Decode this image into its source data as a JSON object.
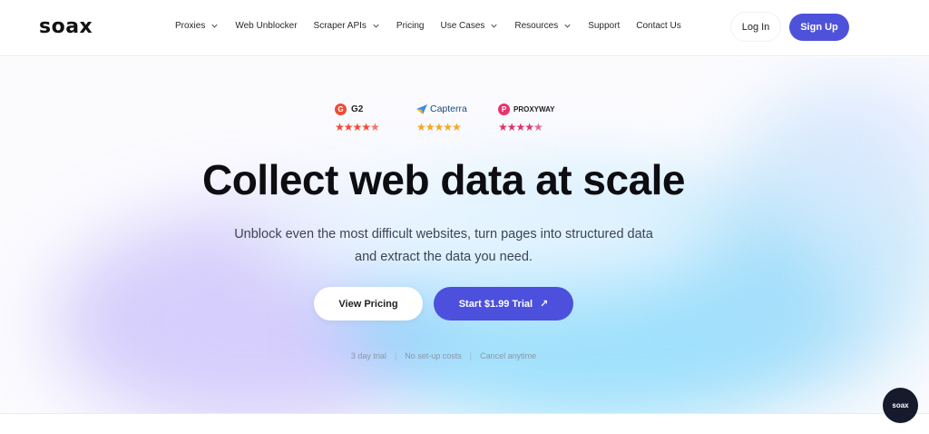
{
  "header": {
    "logo": "soax",
    "nav": [
      {
        "label": "Proxies",
        "dropdown": true
      },
      {
        "label": "Web Unblocker",
        "dropdown": false
      },
      {
        "label": "Scraper APIs",
        "dropdown": true
      },
      {
        "label": "Pricing",
        "dropdown": false
      },
      {
        "label": "Use Cases",
        "dropdown": true
      },
      {
        "label": "Resources",
        "dropdown": true
      },
      {
        "label": "Support",
        "dropdown": false
      },
      {
        "label": "Contact Us",
        "dropdown": false
      }
    ],
    "login_label": "Log In",
    "signup_label": "Sign Up"
  },
  "ratings": [
    {
      "name": "G2",
      "stars": 4.5,
      "star_color": "#ef4b36",
      "icon": "g2-logo-icon"
    },
    {
      "name": "Capterra",
      "stars": 5,
      "star_color": "#f5a623",
      "icon": "capterra-logo-icon"
    },
    {
      "name": "PROXYWAY",
      "stars": 4.5,
      "star_color": "#e0336a",
      "icon": "proxyway-logo-icon"
    }
  ],
  "hero": {
    "headline": "Collect web data at scale",
    "subtitle_line1": "Unblock even the most difficult websites, turn pages into structured data",
    "subtitle_line2": "and extract the data you need.",
    "primary_cta": "Start $1.99 Trial",
    "secondary_cta": "View Pricing",
    "perks": [
      "3 day trial",
      "No set-up costs",
      "Cancel anytime"
    ]
  },
  "chat_widget_label": "soax",
  "colors": {
    "accent": "#4e52db",
    "text_dark": "#0d0d12",
    "chat_bg": "#151a2c"
  }
}
